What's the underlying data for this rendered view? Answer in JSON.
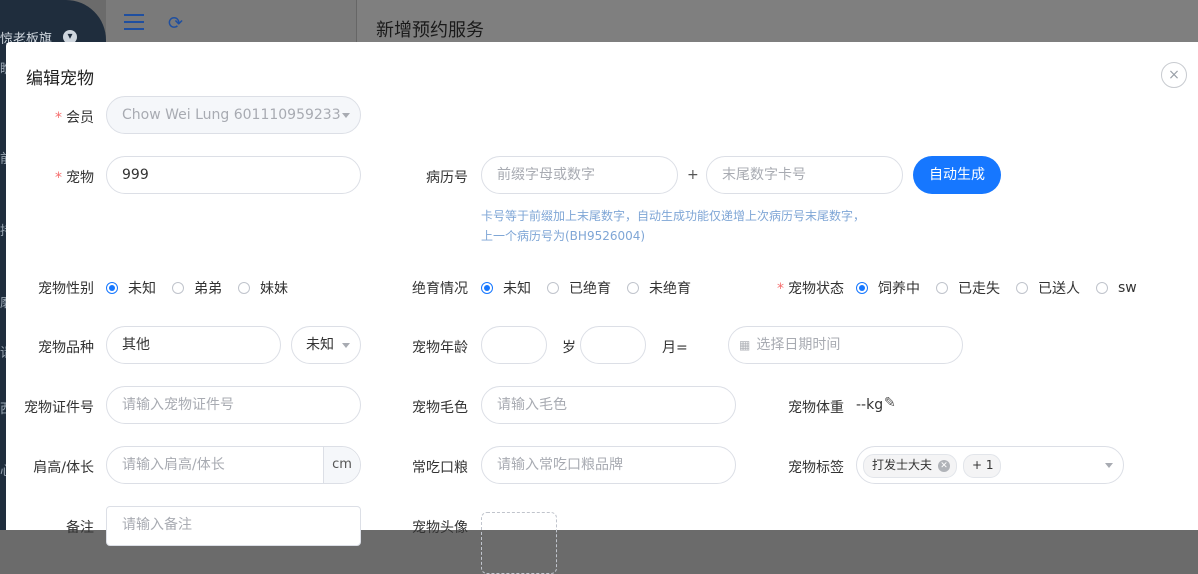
{
  "background": {
    "sidebar_text": "惊老板旗",
    "sidebar_fragments": [
      "瞧",
      "前",
      "持",
      "磨",
      "请",
      "西",
      "心"
    ],
    "panel_title": "新增预约服务"
  },
  "modal": {
    "title": "编辑宠物",
    "close_label": "×"
  },
  "form": {
    "member": {
      "label": "会员",
      "value": "Chow Wei Lung 601110959233"
    },
    "pet": {
      "label": "宠物",
      "value": "999"
    },
    "record": {
      "label": "病历号",
      "prefix_placeholder": "前缀字母或数字",
      "plus": "+",
      "suffix_placeholder": "末尾数字卡号",
      "auto_button": "自动生成",
      "hint_line1": "卡号等于前缀加上末尾数字，自动生成功能仅递增上次病历号末尾数字，",
      "hint_line2": "上一个病历号为(BH9526004)"
    },
    "gender": {
      "label": "宠物性别",
      "options": [
        "未知",
        "弟弟",
        "妹妹"
      ],
      "selected": "未知"
    },
    "neuter": {
      "label": "绝育情况",
      "options": [
        "未知",
        "已绝育",
        "未绝育"
      ],
      "selected": "未知"
    },
    "status": {
      "label": "宠物状态",
      "options": [
        "饲养中",
        "已走失",
        "已送人",
        "sw"
      ],
      "selected": "饲养中"
    },
    "breed": {
      "label": "宠物品种",
      "value": "其他",
      "sub_value": "未知"
    },
    "age": {
      "label": "宠物年龄",
      "year_unit": "岁",
      "month_unit": "月=",
      "date_placeholder": "选择日期时间"
    },
    "cert": {
      "label": "宠物证件号",
      "placeholder": "请输入宠物证件号"
    },
    "color": {
      "label": "宠物毛色",
      "placeholder": "请输入毛色"
    },
    "weight": {
      "label": "宠物体重",
      "value": "--kg"
    },
    "height": {
      "label": "肩高/体长",
      "placeholder": "请输入肩高/体长",
      "unit": "cm"
    },
    "food": {
      "label": "常吃口粮",
      "placeholder": "请输入常吃口粮品牌"
    },
    "tags": {
      "label": "宠物标签",
      "items": [
        "打发士大夫"
      ],
      "more": "+ 1"
    },
    "remark": {
      "label": "备注",
      "placeholder": "请输入备注"
    },
    "avatar": {
      "label": "宠物头像"
    }
  },
  "colors": {
    "primary": "#1677ff",
    "required": "#f56c6c",
    "hint": "#7fa6d6"
  }
}
